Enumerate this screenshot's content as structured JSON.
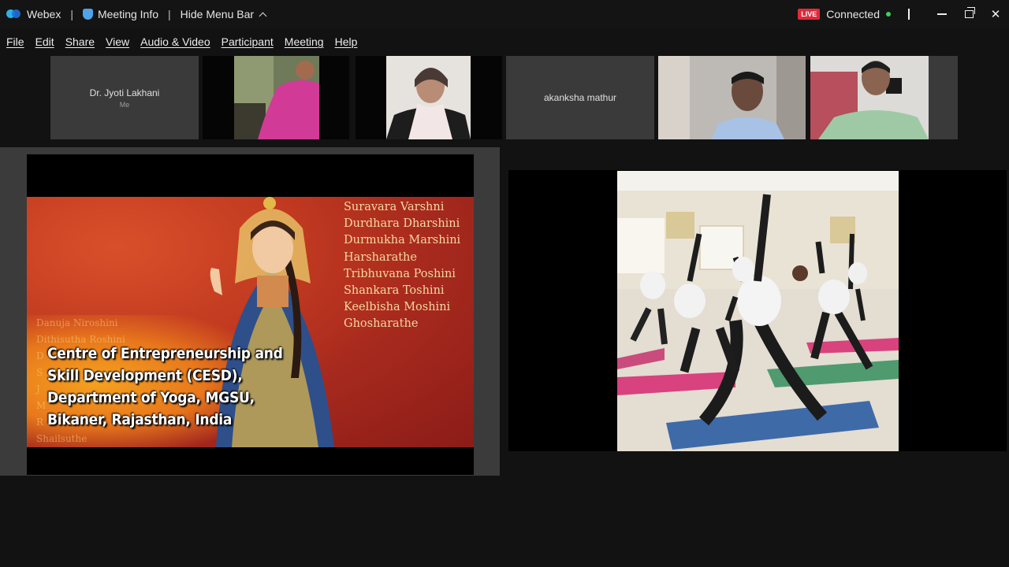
{
  "titlebar": {
    "app_name": "Webex",
    "meeting_info": "Meeting Info",
    "hide_menu_bar": "Hide Menu Bar",
    "live_badge": "LIVE",
    "connection_status": "Connected",
    "status_color": "#3fcf5c"
  },
  "menu": {
    "items": [
      "File",
      "Edit",
      "Share",
      "View",
      "Audio & Video",
      "Participant",
      "Meeting",
      "Help"
    ]
  },
  "participants": [
    {
      "name": "Dr. Jyoti Lakhani",
      "sub": "Me",
      "video": false
    },
    {
      "name": "",
      "video": true,
      "icon": "participant-video-woman-pink"
    },
    {
      "name": "",
      "video": true,
      "icon": "participant-video-woman-white"
    },
    {
      "name": "akanksha mathur",
      "video": false
    },
    {
      "name": "",
      "video": true,
      "icon": "participant-video-man-blue-shirt"
    },
    {
      "name": "",
      "video": true,
      "icon": "participant-video-man-green-shirt"
    }
  ],
  "slide": {
    "poem_lines": [
      "Suravara Varshni",
      "Durdhara Dharshini",
      "Durmukha Marshini",
      "Harsharathe",
      "Tribhuvana Poshini",
      "Shankara Toshini",
      "Keelbisha Moshini",
      "Ghosharathe"
    ],
    "ghost_lines": [
      "Danuja Niroshini",
      "Dithisutha Roshini",
      "D",
      "S",
      "J",
      "M",
      "R",
      "Shailsuthe"
    ],
    "caption_lines": [
      "Centre of Entrepreneurship and",
      "Skill Development (CESD),",
      "Department of Yoga, MGSU,",
      "Bikaner, Rajasthan, India"
    ]
  },
  "colors": {
    "accent": "#e02a3a",
    "background": "#121212",
    "tile": "#3a3a3a"
  }
}
